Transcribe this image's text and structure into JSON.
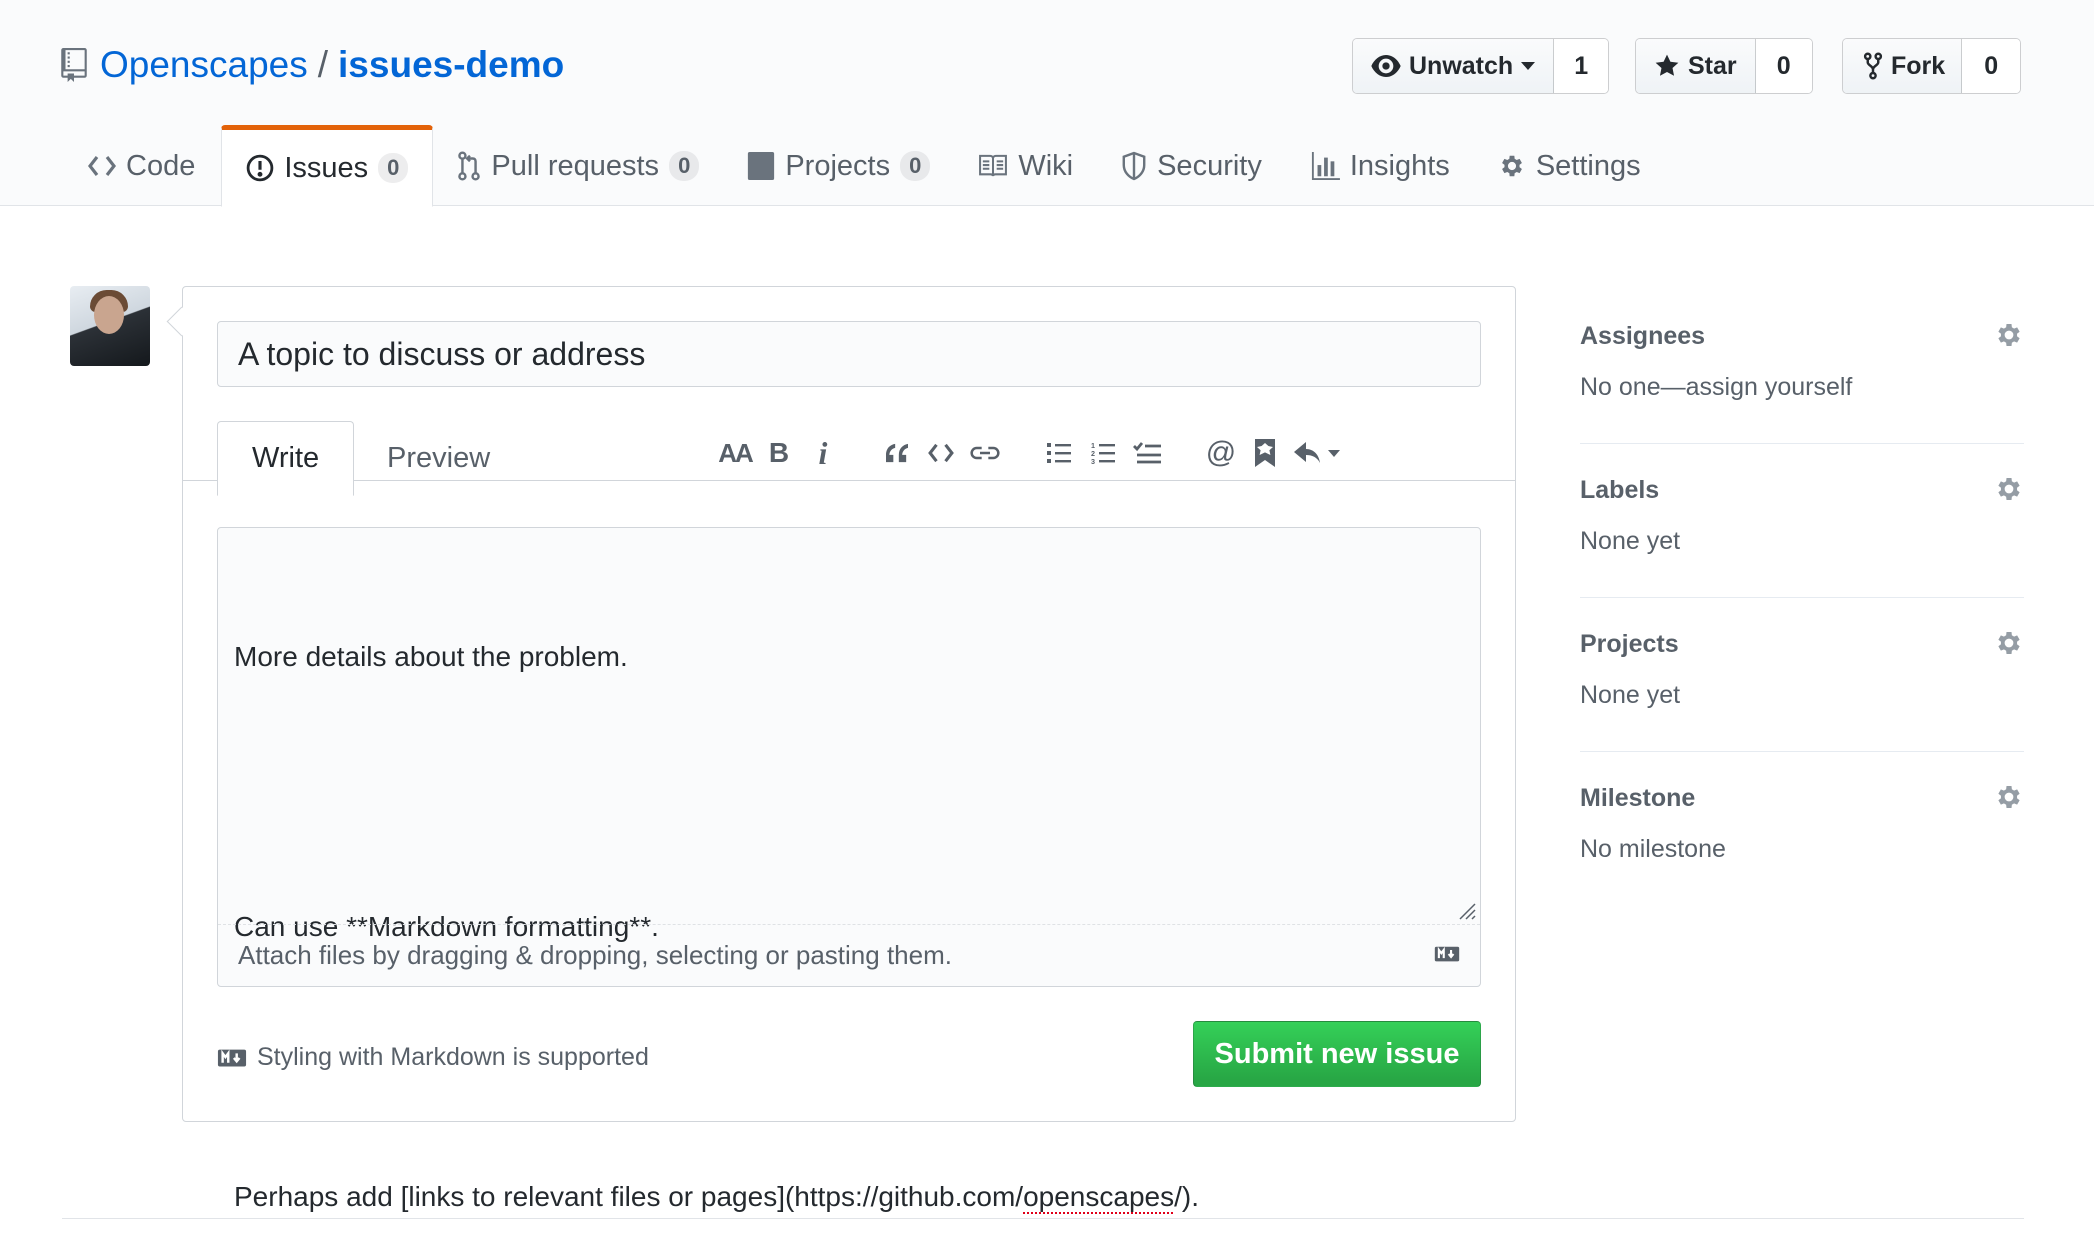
{
  "repo": {
    "owner": "Openscapes",
    "separator": "/",
    "name": "issues-demo"
  },
  "actions": {
    "watch": {
      "label": "Unwatch",
      "count": "1"
    },
    "star": {
      "label": "Star",
      "count": "0"
    },
    "fork": {
      "label": "Fork",
      "count": "0"
    }
  },
  "nav": {
    "code": "Code",
    "issues": "Issues",
    "issues_count": "0",
    "pulls": "Pull requests",
    "pulls_count": "0",
    "projects": "Projects",
    "projects_count": "0",
    "wiki": "Wiki",
    "security": "Security",
    "insights": "Insights",
    "settings": "Settings"
  },
  "form": {
    "title_value": "A topic to discuss or address",
    "tab_write": "Write",
    "tab_preview": "Preview",
    "toolbar": {
      "header": "AA",
      "bold": "B",
      "italic": "i",
      "at": "@"
    },
    "body_line_1": "More details about the problem.",
    "body_line_2": "Can use **Markdown formatting**.",
    "body_line_3_before": "Perhaps add [links to relevant files or pages](https://github.com/",
    "body_line_3_spell": "openscapes",
    "body_line_3_after": "/).",
    "attach_hint": "Attach files by dragging & dropping, selecting or pasting them.",
    "markdown_hint": "Styling with Markdown is supported",
    "submit_label": "Submit new issue"
  },
  "sidebar": {
    "assignees": {
      "heading": "Assignees",
      "value": "No one—assign yourself"
    },
    "labels": {
      "heading": "Labels",
      "value": "None yet"
    },
    "projects": {
      "heading": "Projects",
      "value": "None yet"
    },
    "milestone": {
      "heading": "Milestone",
      "value": "No milestone"
    }
  },
  "colors": {
    "link": "#0366d6",
    "tab_accent": "#e36209",
    "submit": "#28a745"
  }
}
